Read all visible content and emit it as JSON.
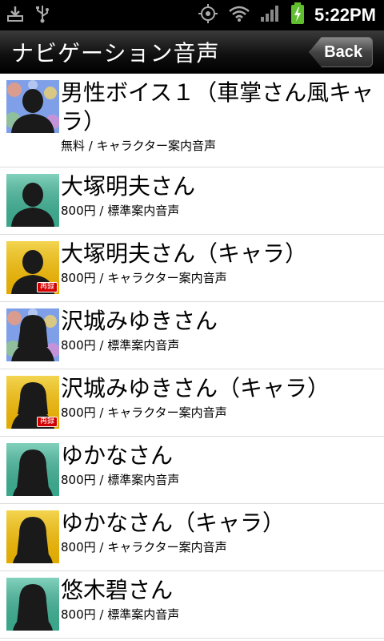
{
  "status": {
    "time": "5:22PM"
  },
  "header": {
    "title": "ナビゲーション音声",
    "back_label": "Back"
  },
  "colors": {
    "teal": "#3fb99a",
    "yellow": "#e8b400",
    "blue": "#7fa0e8",
    "tag_red": "#d20000"
  },
  "items": [
    {
      "name": "男性ボイス１（車掌さん風キャラ）",
      "sub": "無料 / キャラクター案内音声",
      "avatar_style": "blue-male",
      "tag": ""
    },
    {
      "name": "大塚明夫さん",
      "sub": "800円 / 標準案内音声",
      "avatar_style": "teal-male",
      "tag": ""
    },
    {
      "name": "大塚明夫さん（キャラ）",
      "sub": "800円 / キャラクター案内音声",
      "avatar_style": "yellow-male",
      "tag": "再録"
    },
    {
      "name": "沢城みゆきさん",
      "sub": "800円 / 標準案内音声",
      "avatar_style": "blue-female",
      "tag": ""
    },
    {
      "name": "沢城みゆきさん（キャラ）",
      "sub": "800円 / キャラクター案内音声",
      "avatar_style": "yellow-female",
      "tag": "再録"
    },
    {
      "name": "ゆかなさん",
      "sub": "800円 / 標準案内音声",
      "avatar_style": "teal-longhair",
      "tag": ""
    },
    {
      "name": "ゆかなさん（キャラ）",
      "sub": "800円 / キャラクター案内音声",
      "avatar_style": "yellow-longhair",
      "tag": ""
    },
    {
      "name": "悠木碧さん",
      "sub": "800円 / 標準案内音声",
      "avatar_style": "teal-longhair",
      "tag": ""
    }
  ]
}
